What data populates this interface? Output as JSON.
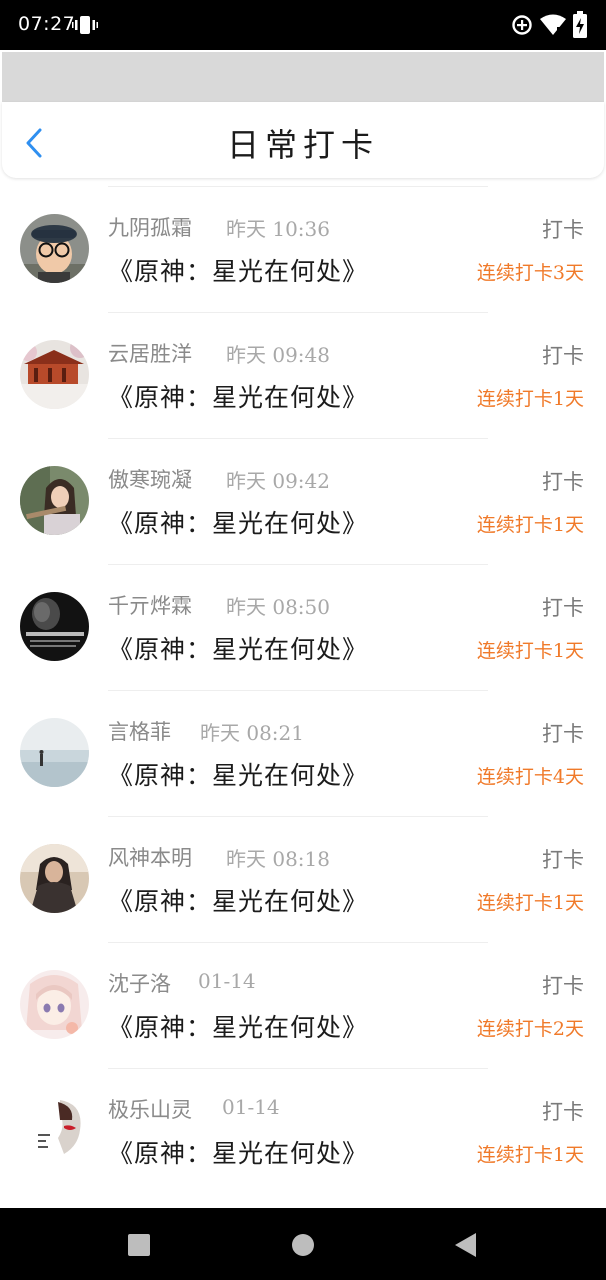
{
  "status_bar": {
    "time": "07:27",
    "icons": [
      "vibrate-icon",
      "data-saver-icon",
      "wifi-icon",
      "battery-icon"
    ]
  },
  "header": {
    "title": "日常打卡",
    "back_icon": "chevron-left-icon",
    "accent_color": "#2f8ff0"
  },
  "checkins": [
    {
      "name": "九阴孤霜",
      "time": "昨天 10:36",
      "book": "《原神：星光在何处》",
      "action": "打卡",
      "streak": "连续打卡3天",
      "avatar": "boy-with-glasses"
    },
    {
      "name": "云居胜洋",
      "time": "昨天 09:48",
      "book": "《原神：星光在何处》",
      "action": "打卡",
      "streak": "连续打卡1天",
      "avatar": "temple-blossoms"
    },
    {
      "name": "傲寒琬凝",
      "time": "昨天 09:42",
      "book": "《原神：星光在何处》",
      "action": "打卡",
      "streak": "连续打卡1天",
      "avatar": "girl-portrait"
    },
    {
      "name": "千亓烨霖",
      "time": "昨天 08:50",
      "book": "《原神：星光在何处》",
      "action": "打卡",
      "streak": "连续打卡1天",
      "avatar": "dark-text-image"
    },
    {
      "name": "言格菲",
      "time": "昨天 08:21",
      "book": "《原神：星光在何处》",
      "action": "打卡",
      "streak": "连续打卡4天",
      "avatar": "seaside"
    },
    {
      "name": "风神本明",
      "time": "昨天 08:18",
      "book": "《原神：星光在何处》",
      "action": "打卡",
      "streak": "连续打卡1天",
      "avatar": "sitting-figure"
    },
    {
      "name": "沈子洛",
      "time": "01-14",
      "book": "《原神：星光在何处》",
      "action": "打卡",
      "streak": "连续打卡2天",
      "avatar": "anime-girl"
    },
    {
      "name": "极乐山灵",
      "time": "01-14",
      "book": "《原神：星光在何处》",
      "action": "打卡",
      "streak": "连续打卡1天",
      "avatar": "red-lips"
    }
  ],
  "colors": {
    "streak": "#f07a2a",
    "name": "#8a8a8a",
    "divider": "#eeeeee"
  },
  "nav_bar": {
    "buttons": [
      "recents-button",
      "home-button",
      "back-button"
    ]
  }
}
